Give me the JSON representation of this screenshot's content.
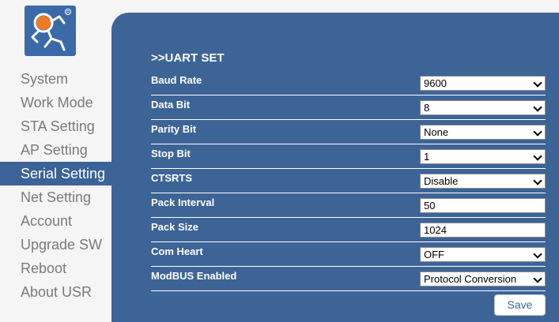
{
  "sidebar": {
    "items": [
      {
        "label": "System"
      },
      {
        "label": "Work Mode"
      },
      {
        "label": "STA Setting"
      },
      {
        "label": "AP Setting"
      },
      {
        "label": "Serial Setting",
        "active": true
      },
      {
        "label": "Net Setting"
      },
      {
        "label": "Account"
      },
      {
        "label": "Upgrade SW"
      },
      {
        "label": "Reboot"
      },
      {
        "label": "About USR"
      }
    ]
  },
  "main": {
    "title": ">>UART SET",
    "fields": [
      {
        "label": "Baud Rate",
        "type": "select",
        "value": "9600"
      },
      {
        "label": "Data Bit",
        "type": "select",
        "value": "8"
      },
      {
        "label": "Parity Bit",
        "type": "select",
        "value": "None"
      },
      {
        "label": "Stop Bit",
        "type": "select",
        "value": "1"
      },
      {
        "label": "CTSRTS",
        "type": "select",
        "value": "Disable"
      },
      {
        "label": "Pack Interval",
        "type": "input",
        "value": "50"
      },
      {
        "label": "Pack Size",
        "type": "input",
        "value": "1024"
      },
      {
        "label": "Com Heart",
        "type": "select",
        "value": "OFF"
      },
      {
        "label": "ModBUS Enabled",
        "type": "select",
        "value": "Protocol Conversion"
      }
    ],
    "save_label": "Save"
  },
  "colors": {
    "panel": "#3d6497",
    "active_nav": "#3b6299",
    "logo_bg": "#3a6aa8",
    "logo_accent": "#f07a22"
  },
  "icons": {
    "logo": "usr-runner-logo-icon"
  }
}
